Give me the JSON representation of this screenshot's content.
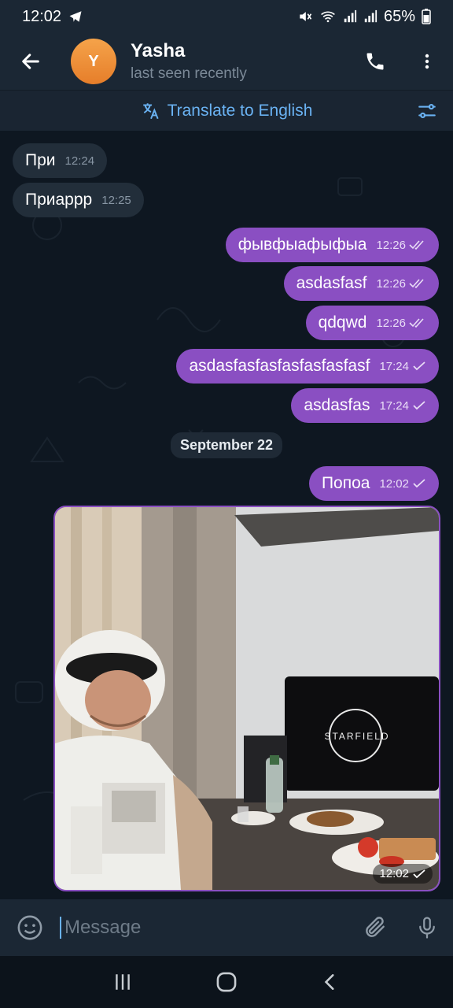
{
  "status_bar": {
    "time": "12:02",
    "battery": "65%"
  },
  "header": {
    "avatar_letter": "Y",
    "name": "Yasha",
    "last_seen": "last seen recently",
    "translate_label": "Translate to English"
  },
  "messages": [
    {
      "dir": "in",
      "text": "При",
      "time": "12:24"
    },
    {
      "dir": "in",
      "text": "Приаррр",
      "time": "12:25"
    },
    {
      "dir": "out",
      "text": "фывфыафыфыа",
      "time": "12:26"
    },
    {
      "dir": "out",
      "text": "asdasfasf",
      "time": "12:26"
    },
    {
      "dir": "out",
      "text": "qdqwd",
      "time": "12:26"
    },
    {
      "dir": "out",
      "text": "asdasfasfasfasfasfasfasf",
      "time": "17:24"
    },
    {
      "dir": "out",
      "text": "asdasfas",
      "time": "17:24"
    },
    {
      "dir": "out",
      "text": "Попоа",
      "time": "12:02"
    }
  ],
  "date_separator": "September 22",
  "photo_message": {
    "time": "12:02",
    "monitor_text": "STARFIELD"
  },
  "composer": {
    "placeholder": "Message"
  },
  "colors": {
    "outgoing_bubble": "#8a4fc2",
    "incoming_bubble": "#222e3a",
    "accent": "#6ab2f2",
    "avatar": "#f0923a"
  }
}
